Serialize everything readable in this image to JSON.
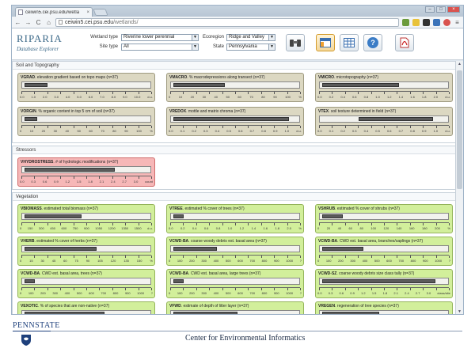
{
  "browser": {
    "tab_title": "ceiwin5.cei.psu.edu/wetla",
    "tab_close": "×",
    "url_domain": "ceiwin5.cei.psu.edu",
    "url_path": "/wetlands/",
    "back": "←",
    "forward": "→",
    "reload": "C",
    "home": "⌂",
    "menu": "≡",
    "win_min": "–",
    "win_max": "□",
    "win_close": "×"
  },
  "app": {
    "logo_title": "RIPARIA",
    "logo_subtitle": "Database Explorer",
    "filters": {
      "wetland_type_label": "Wetland type",
      "wetland_type_value": "Riverine lower perennial",
      "site_type_label": "Site type",
      "site_type_value": "All",
      "ecoregion_label": "Ecoregion",
      "ecoregion_value": "Ridge and Valley",
      "state_label": "State",
      "state_value": "Pennsylvania"
    },
    "toolbar_icons": [
      "binoculars-icon",
      "table-layout-icon",
      "grid-icon",
      "help-icon",
      "pdf-icon"
    ],
    "help_glyph": "?"
  },
  "sections": {
    "soil": "Soil and Topography",
    "stressors": "Stressors",
    "vegetation": "Vegetation"
  },
  "cards": {
    "vgrad": {
      "code": "VGRAD",
      "desc": ". elevation gradient based on topo maps (n=37)",
      "scale": [
        "0.0",
        "1.0",
        "2.0",
        "3.0",
        "4.0",
        "5.0",
        "6.0",
        "7.0",
        "8.0",
        "9.0",
        "10.0",
        "d.u."
      ],
      "range": [
        0.02,
        0.2
      ]
    },
    "vmacro": {
      "code": "VMACRO",
      "desc": ". % macrodepressions along transect (n=37)",
      "scale": [
        "0",
        "10",
        "20",
        "30",
        "40",
        "50",
        "60",
        "70",
        "80",
        "90",
        "100",
        "%"
      ],
      "range": [
        0.02,
        0.42
      ]
    },
    "vmicro": {
      "code": "VMICRO",
      "desc": ". microtopography (n=37)",
      "scale": [
        "0.0",
        "0.2",
        "0.4",
        "0.6",
        "0.8",
        "1.0",
        "1.2",
        "1.4",
        "1.6",
        "1.8",
        "2.0",
        "d.u."
      ],
      "range": [
        0.02,
        0.62
      ]
    },
    "vorgin": {
      "code": "VORGIN",
      "desc": ". % organic content in top 5 cm of soil (n=37)",
      "scale": [
        "0",
        "10",
        "20",
        "30",
        "40",
        "50",
        "60",
        "70",
        "80",
        "90",
        "100",
        "%"
      ],
      "range": [
        0.02,
        0.12
      ]
    },
    "vredox": {
      "code": "VREDOX",
      "desc": ". mottle and matrix chroma (n=37)",
      "scale": [
        "0.0",
        "0.1",
        "0.2",
        "0.3",
        "0.4",
        "0.5",
        "0.6",
        "0.7",
        "0.8",
        "0.9",
        "1.0",
        "d.u."
      ],
      "range": [
        0.02,
        0.92
      ]
    },
    "vtex": {
      "code": "VTEX",
      "desc": ". soil texture determined in field (n=37)",
      "scale": [
        "0.0",
        "0.1",
        "0.2",
        "0.3",
        "0.4",
        "0.5",
        "0.6",
        "0.7",
        "0.8",
        "0.9",
        "1.0",
        "d.u."
      ],
      "range": [
        0.3,
        0.88
      ]
    },
    "vhydro": {
      "code": "VHYDROSTRESS",
      "desc": ". # of hydrologic modifications (n=37)",
      "scale": [
        "0.0",
        "0.3",
        "0.6",
        "0.9",
        "1.2",
        "1.5",
        "1.8",
        "2.1",
        "2.4",
        "2.7",
        "3.0",
        "count"
      ],
      "range": [
        0.02,
        0.72
      ]
    },
    "vbiomass": {
      "code": "VBIOMASS",
      "desc": ". estimated total biomass (n=37)",
      "scale": [
        "0",
        "150",
        "300",
        "450",
        "600",
        "750",
        "900",
        "1050",
        "1200",
        "1350",
        "1500",
        "d.u."
      ],
      "range": [
        0.02,
        0.46
      ]
    },
    "vtree": {
      "code": "VTREE",
      "desc": ". estimated % cover of trees (n=37)",
      "scale": [
        "0.0",
        "0.2",
        "0.4",
        "0.6",
        "0.8",
        "1.0",
        "1.2",
        "1.4",
        "1.6",
        "1.8",
        "2.0",
        "%"
      ],
      "range": [
        0.02,
        0.1
      ]
    },
    "vshrub": {
      "code": "VSHRUB",
      "desc": ". estimated % cover of shrubs (n=37)",
      "scale": [
        "0",
        "20",
        "40",
        "60",
        "80",
        "100",
        "120",
        "140",
        "160",
        "180",
        "200",
        "%"
      ],
      "range": [
        0.02,
        0.18
      ]
    },
    "vherb": {
      "code": "VHERB",
      "desc": ". estimated % cover of herbs (n=37)",
      "scale": [
        "0",
        "15",
        "30",
        "45",
        "60",
        "75",
        "90",
        "105",
        "120",
        "135",
        "150",
        "%"
      ],
      "range": [
        0.02,
        0.58
      ]
    },
    "vcwd_ba": {
      "code": "VCWD-BA",
      "desc": ". coarse woody debris est. basal area (n=37)",
      "scale": [
        "0",
        "100",
        "200",
        "300",
        "400",
        "500",
        "600",
        "700",
        "800",
        "900",
        "1000",
        "?"
      ],
      "range": [
        0.02,
        0.36
      ]
    },
    "vcwd_ba_br": {
      "code": "VCWD-BA",
      "desc": ". CWD est. basal area, branches/saplings (n=37)",
      "scale": [
        "0",
        "100",
        "200",
        "300",
        "400",
        "500",
        "600",
        "700",
        "800",
        "900",
        "1000",
        "?"
      ],
      "range": [
        0.02,
        0.34
      ]
    },
    "vcwd_ba_tr": {
      "code": "VCWD-BA",
      "desc": ". CWD est. basal area, trees (n=37)",
      "scale": [
        "0",
        "100",
        "200",
        "300",
        "400",
        "500",
        "600",
        "700",
        "800",
        "900",
        "1000",
        "?"
      ],
      "range": [
        0.02,
        0.1
      ]
    },
    "vcwd_ba_lt": {
      "code": "VCWD-BA",
      "desc": ". CWD est. basal area, large trees (n=37)",
      "scale": [
        "0",
        "100",
        "200",
        "300",
        "400",
        "500",
        "600",
        "700",
        "800",
        "900",
        "1000",
        "?"
      ],
      "range": [
        0.02,
        0.1
      ]
    },
    "vcwd_sz": {
      "code": "VCWD-SZ",
      "desc": ". coarse woody debris size class tally (n=37)",
      "scale": [
        "0.0",
        "0.3",
        "0.6",
        "0.9",
        "1.2",
        "1.5",
        "1.8",
        "2.1",
        "2.4",
        "2.7",
        "3.0",
        "class/site"
      ],
      "range": [
        0.02,
        0.9
      ]
    },
    "vexotic": {
      "code": "VEXOTIC",
      "desc": ". % of species that are non-native (n=37)",
      "scale": [],
      "range": [
        0.02,
        0.64
      ]
    },
    "vfwd": {
      "code": "VFWD",
      "desc": ". estimate of depth of litter layer (n=37)",
      "scale": [],
      "range": [
        0.02,
        0.52
      ]
    },
    "vregen": {
      "code": "VREGEN",
      "desc": ". regeneration of tree species (n=37)",
      "scale": [],
      "range": [
        0.02,
        0.46
      ]
    }
  },
  "footer": {
    "university": "PENNSTATE",
    "center": "Center for Environmental Informatics"
  }
}
